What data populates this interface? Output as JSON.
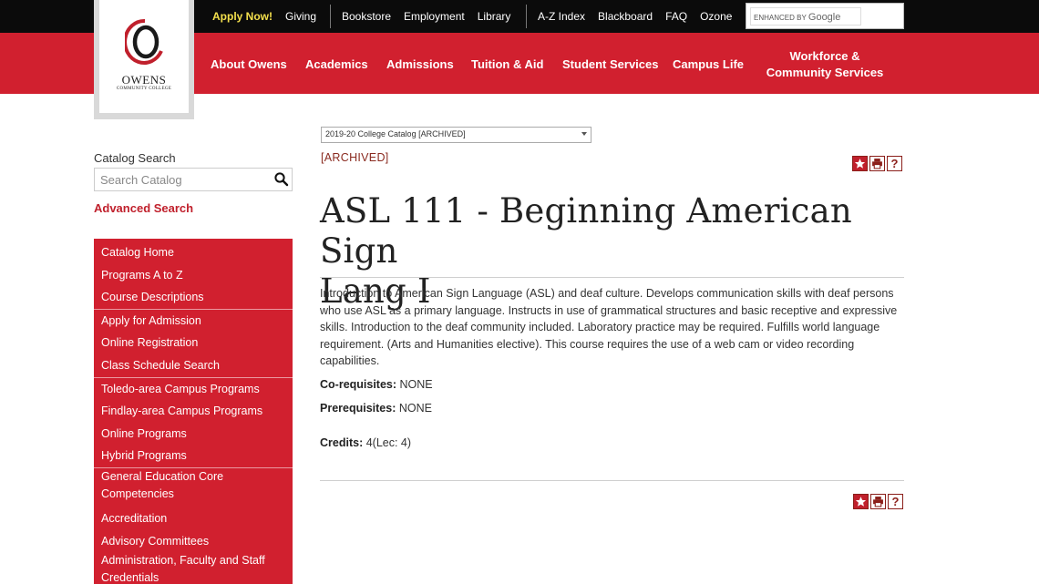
{
  "top_links_group1": [
    "Apply Now!",
    "Giving"
  ],
  "top_links_group2": [
    "Bookstore",
    "Employment",
    "Library"
  ],
  "top_links_group3": [
    "A-Z Index",
    "Blackboard",
    "FAQ",
    "Ozone"
  ],
  "google_search": {
    "enhanced_by": "ENHANCED BY",
    "google": "Google"
  },
  "nav": {
    "about": "About Owens",
    "academics": "Academics",
    "admissions": "Admissions",
    "tuition": "Tuition & Aid",
    "student_services": "Student Services",
    "campus_life": "Campus Life",
    "workforce_line1": "Workforce &",
    "workforce_line2": "Community Services"
  },
  "logo": {
    "name": "OWENS",
    "sub": "COMMUNITY COLLEGE",
    "brand_color": "#c0202c"
  },
  "sidebar": {
    "search_label": "Catalog Search",
    "search_placeholder": "Search Catalog",
    "advanced_search": "Advanced Search",
    "menu": [
      {
        "lines": [
          "Catalog Home"
        ]
      },
      {
        "lines": [
          "Programs A to Z"
        ]
      },
      {
        "lines": [
          "Course Descriptions"
        ]
      },
      {
        "lines": [
          "Apply for Admission"
        ],
        "sep_before": true
      },
      {
        "lines": [
          "Online Registration"
        ]
      },
      {
        "lines": [
          "Class Schedule Search"
        ]
      },
      {
        "lines": [
          "Toledo-area Campus Programs"
        ],
        "sep_before": true
      },
      {
        "lines": [
          "Findlay-area Campus Programs"
        ]
      },
      {
        "lines": [
          "Online Programs"
        ]
      },
      {
        "lines": [
          "Hybrid Programs"
        ]
      },
      {
        "lines": [
          "General Education Core",
          "Competencies"
        ],
        "sep_before": true
      },
      {
        "lines": [
          "Accreditation"
        ]
      },
      {
        "lines": [
          "Advisory Committees"
        ]
      },
      {
        "lines": [
          "Administration, Faculty and Staff",
          "Credentials"
        ]
      }
    ]
  },
  "content": {
    "catalog_select": "2019-20 College Catalog [ARCHIVED]",
    "archived_label": "[ARCHIVED]",
    "title_line1": "ASL 111 - Beginning American Sign",
    "title_line2": "Lang I",
    "description": "Introduction to American Sign Language (ASL) and deaf culture. Develops communication skills with deaf persons who use ASL as a primary language. Instructs in use of grammatical structures and basic receptive and expressive skills. Introduction to the deaf community included. Laboratory practice may be required. Fulfills world language requirement. (Arts and Humanities elective).  This course requires the use of a web cam or video recording capabilities.",
    "coreq_label": "Co-requisites:",
    "coreq_value": " NONE",
    "prereq_label": "Prerequisites:",
    "prereq_value": " NONE",
    "credits_label": "Credits:",
    "credits_value": " 4(Lec: 4)",
    "help_glyph": "?"
  },
  "colors": {
    "nav_red": "#d1202f",
    "top_black": "#0b0b0b",
    "apply_yellow": "#f4e04d",
    "link_red": "#c0202c"
  }
}
